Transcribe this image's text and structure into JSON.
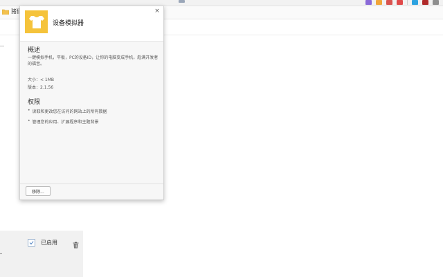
{
  "browser": {
    "toolbar_icon_colors": [
      "#8a6ad8",
      "#f1a63a",
      "#d9534f",
      "#e04a4a",
      "#2ea3e0",
      "#b02a2a",
      "#8f8f8f"
    ],
    "bookmarks": [
      {
        "label": "猪们",
        "icon": "folder-icon"
      }
    ]
  },
  "popup": {
    "extension_name": "设备模拟器",
    "icon": "tshirt-icon",
    "icon_bg_color": "#f5c33b",
    "close_label": "×",
    "overview": {
      "title": "概述",
      "description": "一键模拟手机，平板，PC的设备ID，让你的电脑变成手机，彪满开发者的福音。"
    },
    "size_line": "大小：< 1MB",
    "version_line": "版本：2.1.56",
    "permissions": {
      "title": "权限",
      "items": [
        "读取和更改您在访问的网站上的所有数据",
        "管理您的应用、扩展程序和主题背景"
      ]
    },
    "remove_button": "移除..."
  },
  "extension_card": {
    "enabled_checked": true,
    "enabled_label": "已启用",
    "delete_icon": "trash-icon"
  }
}
